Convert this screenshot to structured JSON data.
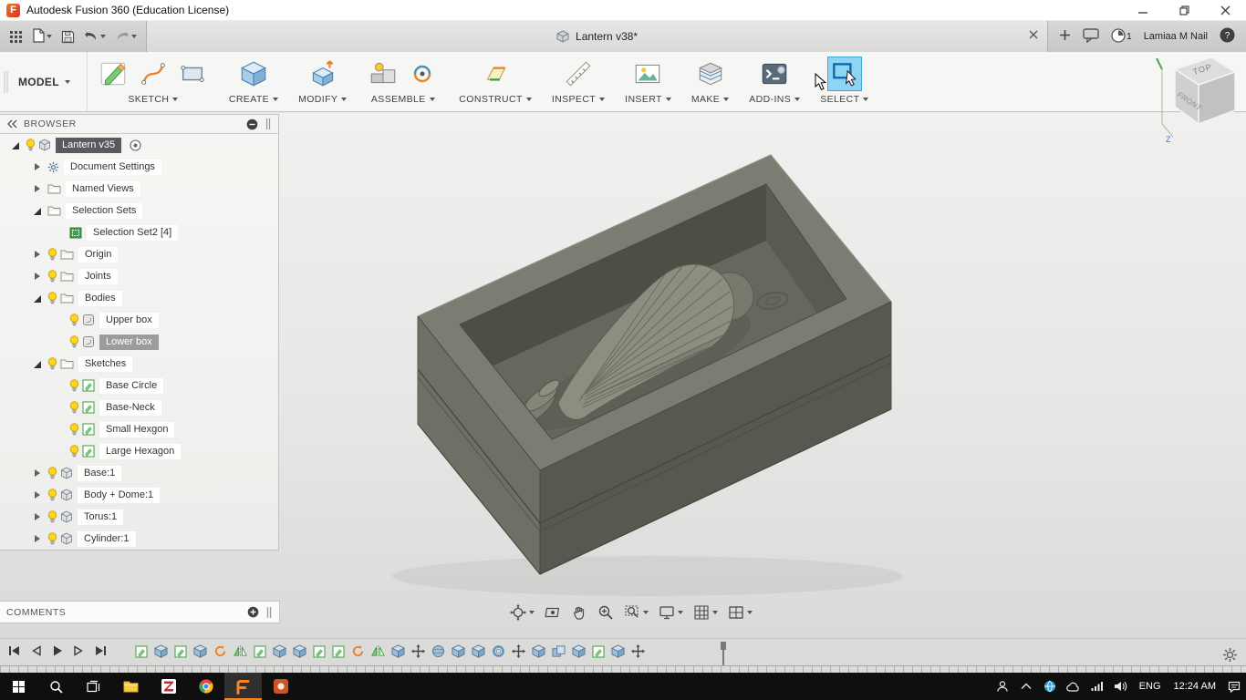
{
  "window": {
    "title": "Autodesk Fusion 360 (Education License)"
  },
  "tab_row": {
    "document_tab": "Lantern v38*",
    "notification_count": "1",
    "user_name": "Lamiaa M Nail"
  },
  "ribbon": {
    "workspace": "MODEL",
    "groups": [
      {
        "label": "SKETCH",
        "icons": [
          "create-sketch",
          "spline",
          "rect-tool"
        ]
      },
      {
        "label": "CREATE",
        "icons": [
          "new-component"
        ]
      },
      {
        "label": "MODIFY",
        "icons": [
          "press-pull"
        ]
      },
      {
        "label": "ASSEMBLE",
        "icons": [
          "assemble",
          "joint"
        ]
      },
      {
        "label": "CONSTRUCT",
        "icons": [
          "plane"
        ]
      },
      {
        "label": "INSPECT",
        "icons": [
          "measure"
        ]
      },
      {
        "label": "INSERT",
        "icons": [
          "canvas"
        ]
      },
      {
        "label": "MAKE",
        "icons": [
          "print3d"
        ]
      },
      {
        "label": "ADD-INS",
        "icons": [
          "scripts"
        ]
      },
      {
        "label": "SELECT",
        "icons": [
          "select"
        ],
        "active": true
      }
    ]
  },
  "browser": {
    "title": "BROWSER",
    "items": [
      {
        "label": "Lantern v35",
        "indent": 0,
        "expander": "expanded",
        "bulb": true,
        "icon": "component",
        "sel": "dark",
        "activate": true
      },
      {
        "label": "Document Settings",
        "indent": 1,
        "expander": "collapsed",
        "bulb": false,
        "icon": "gear"
      },
      {
        "label": "Named Views",
        "indent": 1,
        "expander": "collapsed",
        "bulb": false,
        "icon": "folder"
      },
      {
        "label": "Selection Sets",
        "indent": 1,
        "expander": "expanded",
        "bulb": false,
        "icon": "folder"
      },
      {
        "label": "Selection Set2 [4]",
        "indent": 2,
        "expander": "none",
        "bulb": false,
        "icon": "selection-set"
      },
      {
        "label": "Origin",
        "indent": 1,
        "expander": "collapsed",
        "bulb": true,
        "icon": "folder"
      },
      {
        "label": "Joints",
        "indent": 1,
        "expander": "collapsed",
        "bulb": true,
        "icon": "folder"
      },
      {
        "label": "Bodies",
        "indent": 1,
        "expander": "expanded",
        "bulb": true,
        "icon": "folder"
      },
      {
        "label": "Upper box",
        "indent": 2,
        "expander": "none",
        "bulb": true,
        "icon": "body"
      },
      {
        "label": "Lower box",
        "indent": 2,
        "expander": "none",
        "bulb": true,
        "icon": "body",
        "sel": "gray"
      },
      {
        "label": "Sketches",
        "indent": 1,
        "expander": "expanded",
        "bulb": true,
        "icon": "folder"
      },
      {
        "label": "Base Circle",
        "indent": 2,
        "expander": "none",
        "bulb": true,
        "icon": "sketch"
      },
      {
        "label": "Base-Neck",
        "indent": 2,
        "expander": "none",
        "bulb": true,
        "icon": "sketch"
      },
      {
        "label": "Small Hexgon",
        "indent": 2,
        "expander": "none",
        "bulb": true,
        "icon": "sketch"
      },
      {
        "label": "Large Hexagon",
        "indent": 2,
        "expander": "none",
        "bulb": true,
        "icon": "sketch"
      },
      {
        "label": "Base:1",
        "indent": 1,
        "expander": "collapsed",
        "bulb": true,
        "icon": "component"
      },
      {
        "label": "Body + Dome:1",
        "indent": 1,
        "expander": "collapsed",
        "bulb": true,
        "icon": "component"
      },
      {
        "label": "Torus:1",
        "indent": 1,
        "expander": "collapsed",
        "bulb": true,
        "icon": "component"
      },
      {
        "label": "Cylinder:1",
        "indent": 1,
        "expander": "collapsed",
        "bulb": true,
        "icon": "component"
      }
    ]
  },
  "viewcube": {
    "top_label": "TOP",
    "front_label": "FRONT",
    "axis_label": "Z"
  },
  "comments_panel": {
    "title": "COMMENTS"
  },
  "nav_toolbar": {
    "items": [
      {
        "name": "orbit",
        "caret": true
      },
      {
        "name": "look-at",
        "caret": false
      },
      {
        "name": "pan",
        "caret": false
      },
      {
        "name": "zoom",
        "caret": false
      },
      {
        "name": "fit",
        "caret": true
      },
      {
        "name": "display-settings",
        "caret": true
      },
      {
        "name": "grid-snaps",
        "caret": true
      },
      {
        "name": "viewports",
        "caret": true
      }
    ]
  },
  "timeline": {
    "playback": [
      "go-to-start",
      "step-back",
      "play",
      "step-forward",
      "go-to-end"
    ],
    "features": [
      "sketch",
      "extrude",
      "sketch",
      "extrude",
      "revolve",
      "mirror",
      "sketch",
      "extrude",
      "extrude",
      "sketch",
      "sketch",
      "revolve",
      "mirror",
      "extrude",
      "move",
      "sphere",
      "extrude",
      "extrude",
      "torus",
      "move",
      "extrude",
      "combine",
      "extrude",
      "sketch",
      "extrude",
      "move"
    ]
  },
  "taskbar": {
    "apps": [
      {
        "name": "start"
      },
      {
        "name": "search"
      },
      {
        "name": "task-view"
      },
      {
        "name": "file-explorer"
      },
      {
        "name": "zotero"
      },
      {
        "name": "chrome"
      },
      {
        "name": "fusion-360",
        "active": true
      },
      {
        "name": "autodesk-app"
      }
    ],
    "tray_icons": [
      "tray-user",
      "chevron-up",
      "globe",
      "cloud",
      "signal",
      "volume"
    ],
    "language": "ENG",
    "time": "12:24 AM"
  },
  "colors": {
    "accent_blue": "#0696d7",
    "select_highlight": "#8fd4f2",
    "bulb_yellow": "#ffd21e",
    "model_gray": "#7c7c72"
  }
}
